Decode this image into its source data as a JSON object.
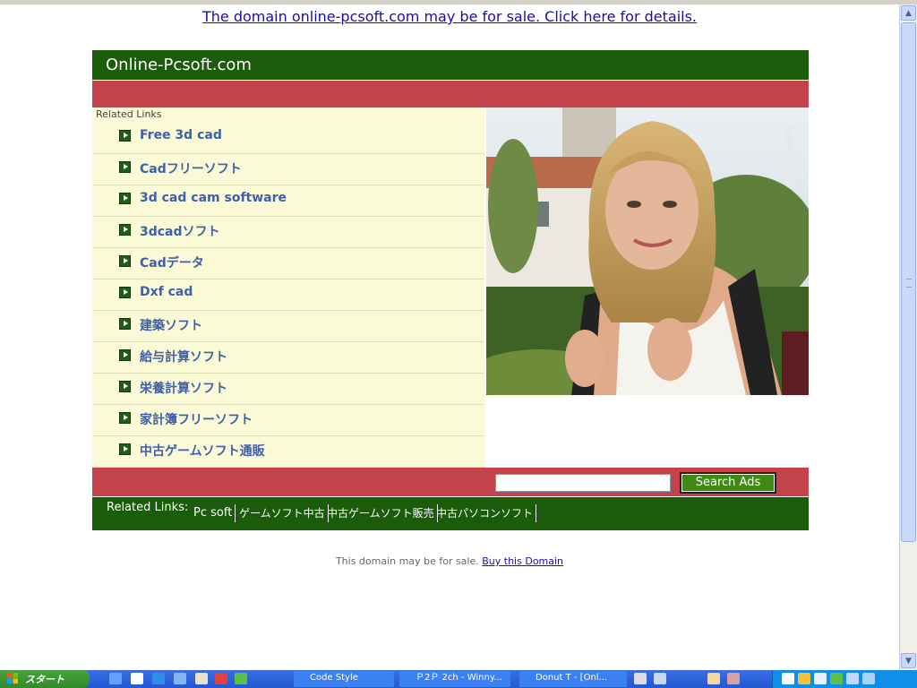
{
  "banner": {
    "sale_text": "The domain online-pcsoft.com may be for sale. Click here for details."
  },
  "header": {
    "site_name": "Online-Pcsoft.com"
  },
  "related_links_panel": {
    "title": "Related Links",
    "items": [
      "Free 3d cad",
      "Cadフリーソフト",
      "3d cad cam software",
      "3dcadソフト",
      "Cadデータ",
      "Dxf cad",
      "建築ソフト",
      "給与計算ソフト",
      "栄養計算ソフト",
      "家計簿フリーソフト",
      "中古ゲームソフト通販"
    ]
  },
  "search": {
    "button_label": "Search Ads",
    "value": ""
  },
  "related_bar": {
    "title": "Related Links:",
    "links": [
      "Pc soft",
      "ゲームソフト中古",
      "中古ゲームソフト販売",
      "中古パソコンソフト"
    ]
  },
  "footer": {
    "text": "This domain may be for sale.",
    "link": "Buy this Domain"
  },
  "taskbar": {
    "start_label": "スタート",
    "tasks": [
      "Code Style",
      "Ｐ2Ｐ 2ch - Winny...",
      "Donut T - [Onl..."
    ]
  },
  "colors": {
    "header_green": "#1a5c0a",
    "band_red": "#c4434a",
    "panel_cream": "#fafad6",
    "link_blue": "#3f5fa8"
  }
}
